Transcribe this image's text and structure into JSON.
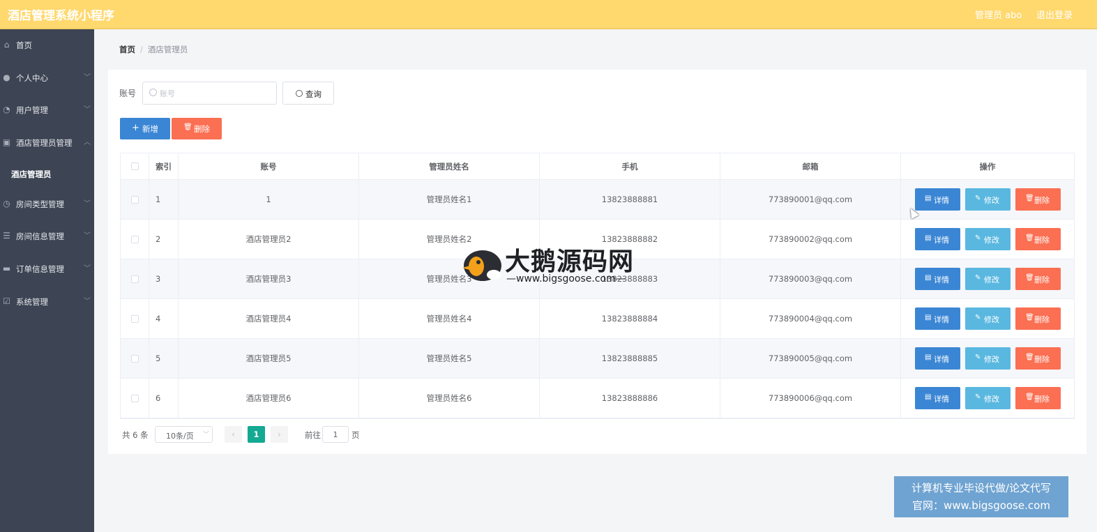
{
  "header": {
    "title": "酒店管理系统小程序",
    "user": "管理员 abo",
    "logout_label": "退出登录"
  },
  "sidebar": {
    "items": [
      {
        "label": "首页",
        "icon": "home-icon",
        "has_arrow": false
      },
      {
        "label": "个人中心",
        "icon": "user-icon",
        "has_arrow": true,
        "arrow": "﹀"
      },
      {
        "label": "用户管理",
        "icon": "gauge-icon",
        "has_arrow": true,
        "arrow": "﹀"
      },
      {
        "label": "酒店管理员管理",
        "icon": "clipboard-icon",
        "has_arrow": true,
        "arrow": "︿"
      },
      {
        "label": "房间类型管理",
        "icon": "clock-icon",
        "has_arrow": true,
        "arrow": "﹀"
      },
      {
        "label": "房间信息管理",
        "icon": "list-icon",
        "has_arrow": true,
        "arrow": "﹀"
      },
      {
        "label": "订单信息管理",
        "icon": "monitor-icon",
        "has_arrow": true,
        "arrow": "﹀"
      },
      {
        "label": "系统管理",
        "icon": "check-square-icon",
        "has_arrow": true,
        "arrow": "﹀"
      }
    ],
    "active_sub": "酒店管理员"
  },
  "breadcrumb": {
    "home": "首页",
    "separator": "/",
    "current": "酒店管理员"
  },
  "search": {
    "label": "账号",
    "placeholder": "账号",
    "value": "",
    "query_label": "查询"
  },
  "toolbar": {
    "add_label": "新增",
    "add_icon": "+",
    "delete_label": "删除",
    "delete_icon": "🗑"
  },
  "table": {
    "columns": [
      "",
      "索引",
      "账号",
      "管理员姓名",
      "手机",
      "邮箱",
      "操作"
    ],
    "rows": [
      {
        "index": "1",
        "account": "1",
        "name": "管理员姓名1",
        "phone": "13823888881",
        "email": "773890001@qq.com"
      },
      {
        "index": "2",
        "account": "酒店管理员2",
        "name": "管理员姓名2",
        "phone": "13823888882",
        "email": "773890002@qq.com"
      },
      {
        "index": "3",
        "account": "酒店管理员3",
        "name": "管理员姓名3",
        "phone": "13823888883",
        "email": "773890003@qq.com"
      },
      {
        "index": "4",
        "account": "酒店管理员4",
        "name": "管理员姓名4",
        "phone": "13823888884",
        "email": "773890004@qq.com"
      },
      {
        "index": "5",
        "account": "酒店管理员5",
        "name": "管理员姓名5",
        "phone": "13823888885",
        "email": "773890005@qq.com"
      },
      {
        "index": "6",
        "account": "酒店管理员6",
        "name": "管理员姓名6",
        "phone": "13823888886",
        "email": "773890006@qq.com"
      }
    ],
    "ops": {
      "detail_label": "详情",
      "detail_icon": "▤",
      "edit_label": "修改",
      "edit_icon": "✎",
      "delete_label": "删除",
      "delete_icon": "🗑"
    }
  },
  "pagination": {
    "total": "共 6 条",
    "page_size": "10条/页",
    "page_size_arrow": "﹀",
    "prev": "‹",
    "next": "›",
    "current_page": "1",
    "goto_pre": "前往",
    "goto_value": "1",
    "goto_post": "页"
  },
  "watermark": {
    "title": "大鹅源码网",
    "subtitle": "—www.bigsgoose.com—",
    "promo_line1": "计算机专业毕设代做/论文代写",
    "promo_line2": "官网：www.bigsgoose.com"
  },
  "colors": {
    "header_bg": "#ffd86e",
    "sidebar_bg": "#3d4453",
    "primary": "#3b86d4",
    "info": "#5ab8e0",
    "danger": "#fb6f52",
    "page_active": "#14a991"
  }
}
